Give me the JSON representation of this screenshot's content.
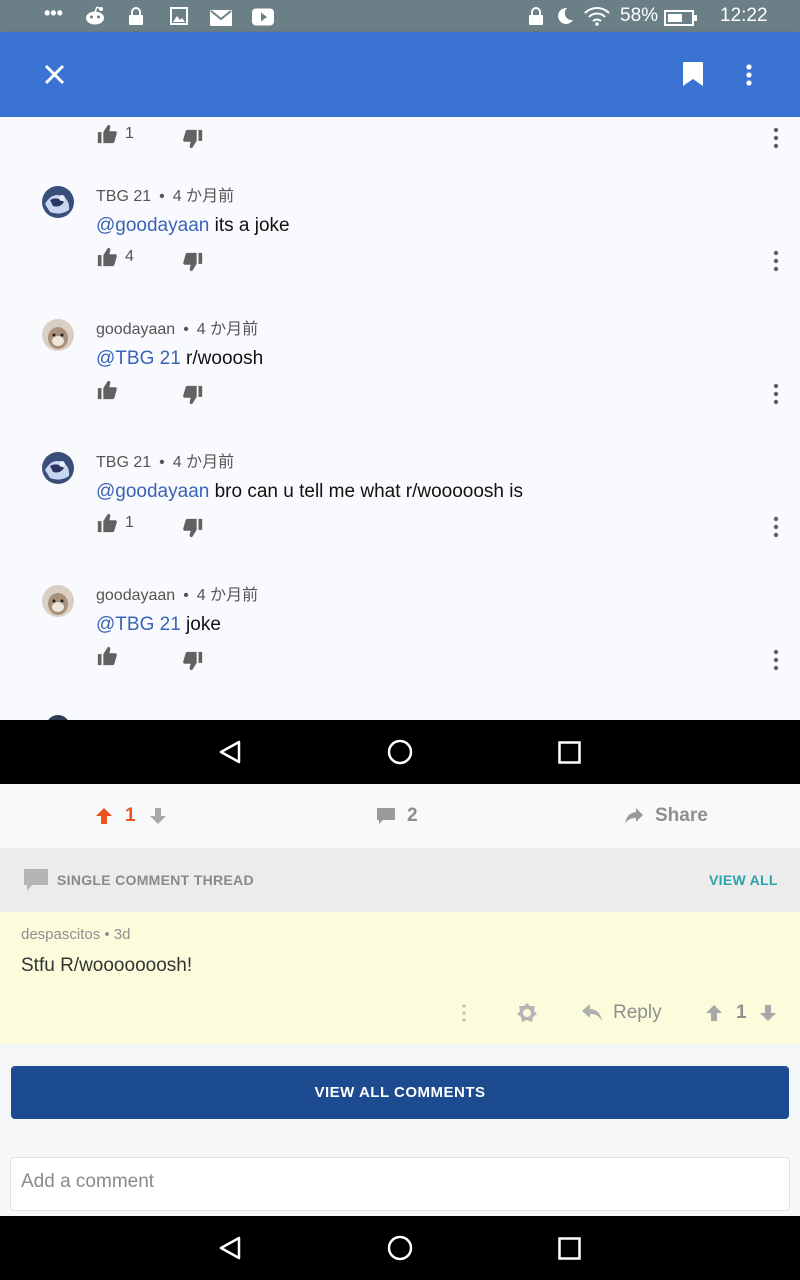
{
  "status_bar": {
    "icons_left": [
      "more-icon",
      "reddit-icon",
      "lock-icon",
      "image-icon",
      "mail-icon",
      "youtube-icon"
    ],
    "icons_right": [
      "lock-icon",
      "moon-icon",
      "wifi-icon"
    ],
    "battery": "58%",
    "time": "12:22"
  },
  "app_bar": {
    "close_icon": "close-icon",
    "bookmark_icon": "bookmark-icon",
    "more_icon": "more-vert-icon",
    "color": "#3b73d3"
  },
  "comments": [
    {
      "author": "",
      "age": "",
      "mention": "",
      "text": "",
      "likes": "1"
    },
    {
      "author": "TBG 21",
      "age": "4 か月前",
      "mention": "@goodayaan",
      "text": " its a joke",
      "likes": "4"
    },
    {
      "author": "goodayaan",
      "age": "4 か月前",
      "mention": "@TBG 21",
      "text": " r/wooosh",
      "likes": ""
    },
    {
      "author": "TBG 21",
      "age": "4 か月前",
      "mention": "@goodayaan",
      "text": " bro can u tell me what r/wooooosh is",
      "likes": "1"
    },
    {
      "author": "goodayaan",
      "age": "4 か月前",
      "mention": "@TBG 21",
      "text": " joke",
      "likes": ""
    }
  ],
  "post_actions": {
    "vote_count": "1",
    "comment_count": "2",
    "share_label": "Share",
    "upvote_color": "#f0521d"
  },
  "thread": {
    "header": "SINGLE COMMENT THREAD",
    "view_all": "VIEW ALL",
    "comment": {
      "meta": "despascitos • 3d",
      "text": "Stfu R/wooooooosh!",
      "reply_label": "Reply",
      "score": "1"
    }
  },
  "view_all_comments": "VIEW ALL COMMENTS",
  "add_comment_placeholder": "Add a comment"
}
